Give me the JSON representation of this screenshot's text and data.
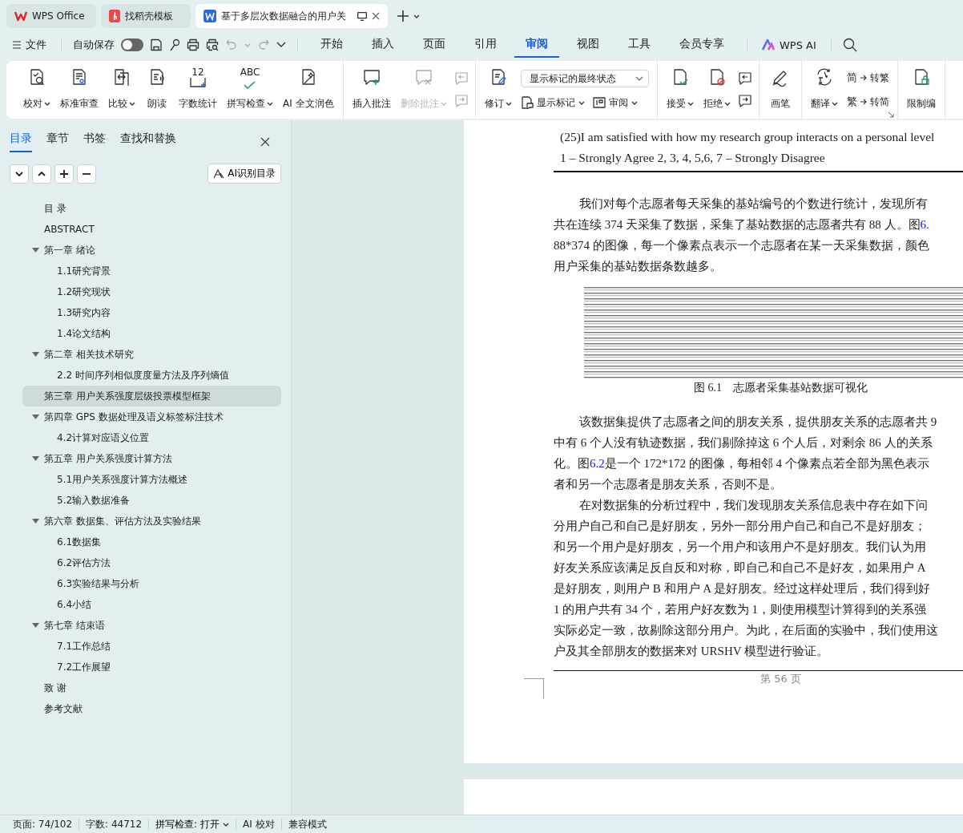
{
  "tabs": [
    {
      "label": "WPS Office",
      "selected": false,
      "kind": "home"
    },
    {
      "label": "找稻壳模板",
      "selected": false,
      "kind": "template"
    },
    {
      "label": "基于多层次数据融合的用户关",
      "selected": true,
      "kind": "document"
    }
  ],
  "menu_bar": {
    "file": "文件",
    "autosave": {
      "label": "自动保存",
      "on": false
    },
    "undo": {
      "disabled": true
    },
    "redo": {
      "disabled": true
    },
    "tabs": [
      {
        "label": "开始",
        "selected": false
      },
      {
        "label": "插入",
        "selected": false
      },
      {
        "label": "页面",
        "selected": false
      },
      {
        "label": "引用",
        "selected": false
      },
      {
        "label": "审阅",
        "selected": true
      },
      {
        "label": "视图",
        "selected": false
      },
      {
        "label": "工具",
        "selected": false
      },
      {
        "label": "会员专享",
        "selected": false
      }
    ],
    "ai": "WPS AI"
  },
  "ribbon": {
    "groups": [
      {
        "items": [
          {
            "kind": "large",
            "label": "校对",
            "dropdown": true,
            "disabled": false
          },
          {
            "kind": "large",
            "label": "标准审查",
            "disabled": false
          },
          {
            "kind": "large",
            "label": "比较",
            "dropdown": true,
            "disabled": false
          },
          {
            "kind": "large",
            "label": "朗读",
            "disabled": false
          },
          {
            "kind": "large",
            "label": "字数统计",
            "icon_text": "12",
            "disabled": false
          },
          {
            "kind": "large",
            "label": "拼写检查",
            "icon_text": "ABC",
            "dropdown": true,
            "disabled": false
          },
          {
            "kind": "large",
            "label": "AI 全文润色",
            "disabled": false
          }
        ]
      },
      {
        "items": [
          {
            "kind": "large",
            "label": "插入批注",
            "disabled": false
          },
          {
            "kind": "large",
            "label": "删除批注",
            "dropdown": true,
            "disabled": true
          },
          {
            "kind": "icons",
            "disabled": true
          }
        ]
      },
      {
        "items": [
          {
            "kind": "large",
            "label": "修订",
            "dropdown": true,
            "disabled": false
          },
          {
            "kind": "stack",
            "select": "显示标记的最终状态",
            "buttons": [
              {
                "label": "显示标记",
                "dropdown": true
              },
              {
                "label": "审阅",
                "dropdown": true
              }
            ]
          }
        ]
      },
      {
        "items": [
          {
            "kind": "large",
            "label": "接受",
            "dropdown": true,
            "disabled": false
          },
          {
            "kind": "large",
            "label": "拒绝",
            "dropdown": true,
            "disabled": false
          },
          {
            "kind": "icons",
            "disabled": false
          }
        ]
      },
      {
        "items": [
          {
            "kind": "large",
            "label": "画笔",
            "disabled": false
          }
        ]
      },
      {
        "items": [
          {
            "kind": "large",
            "label": "翻译",
            "dropdown": true,
            "disabled": false
          },
          {
            "kind": "pair",
            "buttons": [
              {
                "glyph": "简",
                "label": "转繁"
              },
              {
                "glyph": "繁",
                "label": "转简"
              }
            ]
          }
        ],
        "launcher": true
      },
      {
        "items": [
          {
            "kind": "large",
            "label": "限制编",
            "disabled": false
          }
        ]
      }
    ]
  },
  "sidebar": {
    "tabs": [
      {
        "label": "目录",
        "selected": true
      },
      {
        "label": "章节",
        "selected": false
      },
      {
        "label": "书签",
        "selected": false
      },
      {
        "label": "查找和替换",
        "selected": false
      }
    ],
    "ai_button": "AI识别目录",
    "outline": [
      {
        "label": "目 录",
        "selected": false
      },
      {
        "label": "ABSTRACT",
        "selected": false
      },
      {
        "label": "第一章  绪论",
        "selected": false,
        "expanded": true,
        "children": [
          {
            "label": "1.1研究背景",
            "selected": false
          },
          {
            "label": "1.2研究现状",
            "selected": false
          },
          {
            "label": "1.3研究内容",
            "selected": false
          },
          {
            "label": "1.4论文结构",
            "selected": false
          }
        ]
      },
      {
        "label": "第二章  相关技术研究",
        "selected": false,
        "expanded": true,
        "children": [
          {
            "label": "2.2  时间序列相似度度量方法及序列熵值",
            "selected": false
          }
        ]
      },
      {
        "label": "第三章  用户关系强度层级投票模型框架",
        "selected": true
      },
      {
        "label": "第四章  GPS 数据处理及语义标签标注技术",
        "selected": false,
        "expanded": true,
        "children": [
          {
            "label": "4.2计算对应语义位置",
            "selected": false
          }
        ]
      },
      {
        "label": "第五章  用户关系强度计算方法",
        "selected": false,
        "expanded": true,
        "children": [
          {
            "label": "5.1用户关系强度计算方法概述",
            "selected": false
          },
          {
            "label": "5.2输入数据准备",
            "selected": false
          }
        ]
      },
      {
        "label": "第六章  数据集、评估方法及实验结果",
        "selected": false,
        "expanded": true,
        "children": [
          {
            "label": "6.1数据集",
            "selected": false
          },
          {
            "label": "6.2评估方法",
            "selected": false
          },
          {
            "label": "6.3实验结果与分析",
            "selected": false
          },
          {
            "label": "6.4小结",
            "selected": false
          }
        ]
      },
      {
        "label": "第七章  结束语",
        "selected": false,
        "expanded": true,
        "children": [
          {
            "label": "7.1工作总结",
            "selected": false
          },
          {
            "label": "7.2工作展望",
            "selected": false
          }
        ]
      },
      {
        "label": "致  谢",
        "selected": false
      },
      {
        "label": "参考文献",
        "selected": false
      }
    ]
  },
  "document": {
    "blocks": [
      {
        "kind": "line",
        "text": "(25)I am satisfied with how my research group interacts on a personal level"
      },
      {
        "kind": "line",
        "text": "1 – Strongly Agree 2, 3, 4, 5,6, 7 – Strongly Disagree"
      },
      {
        "kind": "rule"
      },
      {
        "kind": "para",
        "lines": [
          [
            {
              "text": "我们对每个志愿者每天采集的基站编号的个数进行统计，发现所有"
            }
          ],
          [
            {
              "text": "共在连续 374 天采集了数据，采集了基站数据的志愿者共有 88 人。图"
            },
            {
              "text": "6.",
              "link": true
            }
          ],
          [
            {
              "text": "88*374 的图像，每一个像素点表示一个志愿者在某一天采集数据，颜色"
            }
          ],
          [
            {
              "text": "用户采集的基站数据条数越多。"
            }
          ]
        ]
      },
      {
        "kind": "figure",
        "caption": "图 6.1    志愿者采集基站数据可视化"
      },
      {
        "kind": "para",
        "lines": [
          [
            {
              "text": "该数据集提供了志愿者之间的朋友关系，提供朋友关系的志愿者共 9"
            }
          ],
          [
            {
              "text": "中有 6 个人没有轨迹数据，我们剔除掉这 6 个人后，对剩余 86 人的关系"
            }
          ],
          [
            {
              "text": "化。图"
            },
            {
              "text": "6.2",
              "link": true
            },
            {
              "text": "是一个 172*172 的图像，每相邻 4 个像素点若全部为黑色表示"
            }
          ],
          [
            {
              "text": "者和另一个志愿者是朋友关系，否则不是。"
            }
          ]
        ]
      },
      {
        "kind": "para",
        "lines": [
          [
            {
              "text": "在对数据集的分析过程中，我们发现朋友关系信息表中存在如下问"
            }
          ],
          [
            {
              "text": "分用户自己和自己是好朋友，另外一部分用户自己和自己不是好朋友；"
            }
          ],
          [
            {
              "text": "和另一个用户是好朋友，另一个用户和该用户不是好朋友。我们认为用"
            }
          ],
          [
            {
              "text": "好友关系应该满足反自反和对称，即自己和自己不是好友，如果用户 A"
            }
          ],
          [
            {
              "text": "是好朋友，则用户 B 和用户 A 是好朋友。经过这样处理后，我们得到好"
            }
          ],
          [
            {
              "text": "1 的用户共有 34 个，若用户好友数为 1，则使用模型计算得到的关系强"
            }
          ],
          [
            {
              "text": "实际必定一致，故剔除这部分用户。为此，在后面的实验中，我们使用这"
            }
          ],
          [
            {
              "text": "户及其全部朋友的数据来对 URSHV 模型进行验证。"
            }
          ]
        ]
      }
    ],
    "footer": "第 56 页"
  },
  "status_bar": [
    {
      "text": "页面: 74/102"
    },
    {
      "text": "字数: 44712"
    },
    {
      "text": "拼写检查: 打开",
      "dropdown": true
    },
    {
      "text": "AI 校对"
    },
    {
      "text": "兼容模式"
    }
  ]
}
